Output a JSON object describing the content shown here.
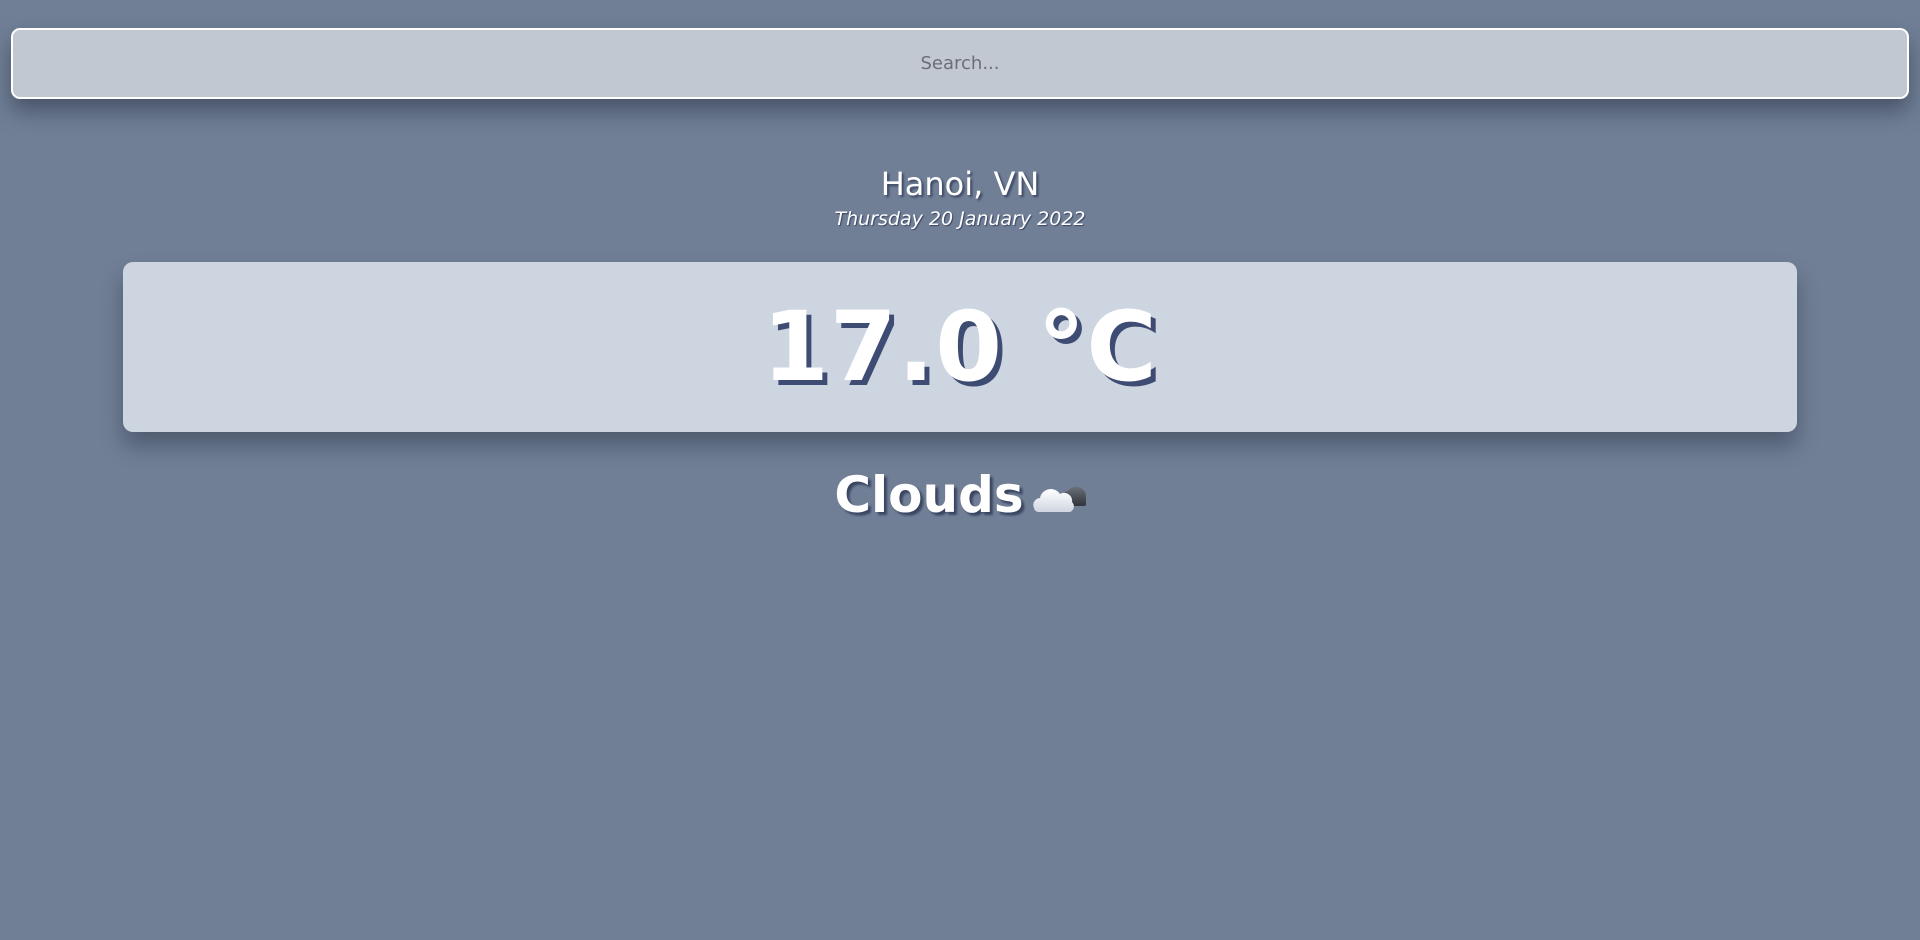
{
  "search": {
    "placeholder": "Search..."
  },
  "location": {
    "name": "Hanoi, VN",
    "date": "Thursday 20 January 2022"
  },
  "current": {
    "temperature": "17.0 °C",
    "condition": "Clouds",
    "condition_icon": "cloud-icon"
  },
  "colors": {
    "background": "#707f96",
    "search_bg": "#c2c8d2",
    "card_bg": "#ccd5e0",
    "temperature_shadow": "#3e4c73",
    "text": "#ffffff"
  }
}
